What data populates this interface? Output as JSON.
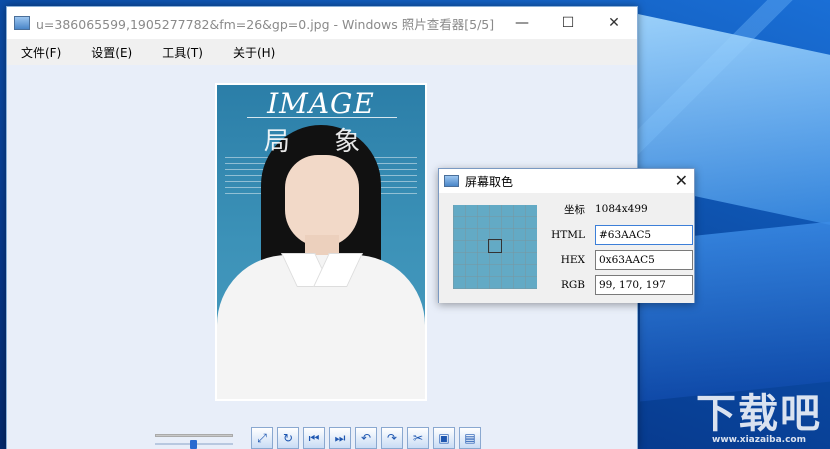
{
  "window": {
    "title": "u=386065599,1905277782&fm=26&gp=0.jpg - Windows 照片查看器[5/5]",
    "minimize": "—",
    "maximize": "☐",
    "close": "✕"
  },
  "menu": {
    "items": [
      {
        "label": "文件(F)"
      },
      {
        "label": "设置(E)"
      },
      {
        "label": "工具(T)"
      },
      {
        "label": "关于(H)"
      }
    ]
  },
  "photo": {
    "title_text": "IMAGE",
    "cn_text": "局  象"
  },
  "toolbar": {
    "buttons": [
      {
        "icon": "fit-screen-icon",
        "glyph": "⤢"
      },
      {
        "icon": "refresh-icon",
        "glyph": "↻"
      },
      {
        "icon": "first-image-icon",
        "glyph": "⏮"
      },
      {
        "icon": "last-image-icon",
        "glyph": "⏭"
      },
      {
        "icon": "rotate-left-icon",
        "glyph": "↶"
      },
      {
        "icon": "rotate-right-icon",
        "glyph": "↷"
      },
      {
        "icon": "cut-icon",
        "glyph": "✂"
      },
      {
        "icon": "save-icon",
        "glyph": "▣"
      },
      {
        "icon": "delete-icon",
        "glyph": "▤"
      }
    ],
    "zoom_level": 0.48
  },
  "color_picker": {
    "title": "屏幕取色",
    "close": "✕",
    "coord_label": "坐标",
    "coord_value": "1084x499",
    "html_label": "HTML",
    "html_value": "#63AAC5",
    "hex_label": "HEX",
    "hex_value": "0x63AAC5",
    "rgb_label": "RGB",
    "rgb_value": "99, 170, 197",
    "sampled_color": "#63AAC5"
  },
  "watermark": {
    "big": "下载吧",
    "small": "www.xiazaiba.com"
  }
}
